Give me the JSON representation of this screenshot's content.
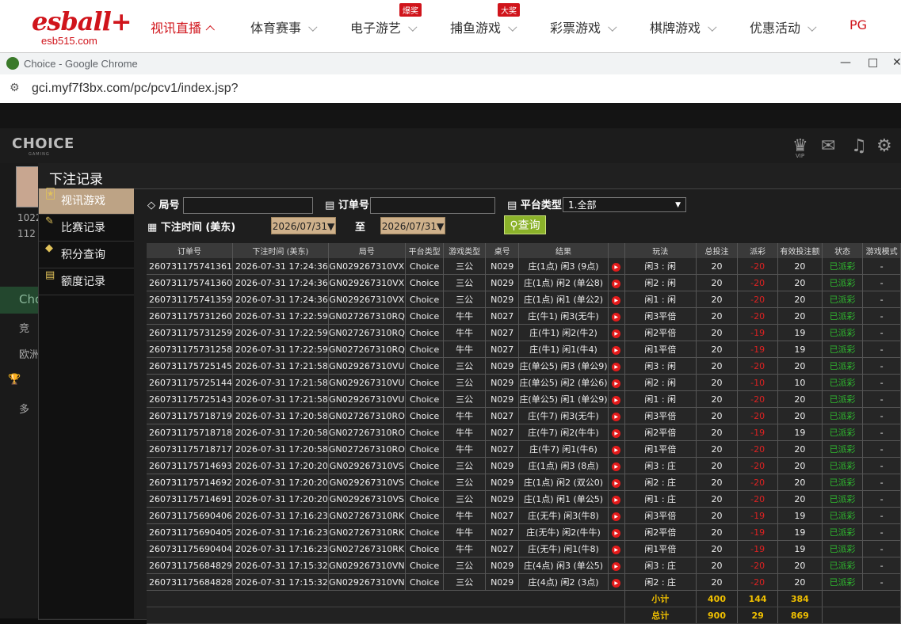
{
  "site": {
    "logo": "esball+",
    "domain": "esb515.com",
    "nav": [
      {
        "label": "视讯直播",
        "active": true
      },
      {
        "label": "体育赛事"
      },
      {
        "label": "电子游艺",
        "badge": "爆奖"
      },
      {
        "label": "捕鱼游戏",
        "badge": "大奖"
      },
      {
        "label": "彩票游戏"
      },
      {
        "label": "棋牌游戏"
      },
      {
        "label": "优惠活动"
      },
      {
        "label": "PG"
      }
    ]
  },
  "chrome": {
    "title": "Choice - Google Chrome",
    "url": "gci.myf7f3bx.com/pc/pcv1/index.jsp?"
  },
  "game": {
    "logo": "CHOICE",
    "logo_sub": "GAMING",
    "vip": "VIP",
    "bg_texts": [
      "1022",
      "112",
      "Cho",
      "竞",
      "欧洲",
      "多"
    ]
  },
  "modal": {
    "title": "下注记录",
    "menu": [
      "视讯游戏",
      "比赛记录",
      "积分查询",
      "额度记录"
    ],
    "filters": {
      "round_label": "局号",
      "order_label": "订单号",
      "platform_label": "平台类型",
      "platform_value": "1.全部",
      "time_label": "下注时间 (美东)",
      "date_from": "2026/07/31▼",
      "to_label": "至",
      "date_to": "2026/07/31▼",
      "query_label": "查询"
    },
    "table": {
      "headers": [
        "订单号",
        "下注时间 (美东)",
        "局号",
        "平台类型",
        "游戏类型",
        "桌号",
        "结果",
        "",
        "玩法",
        "总投注",
        "派彩",
        "有效投注额",
        "状态",
        "游戏模式"
      ],
      "rows": [
        [
          "260731175741361",
          "2026-07-31 17:24:36",
          "GN029267310VX",
          "Choice",
          "三公",
          "N029",
          "庄(1点) 闲3 (9点)",
          "闲3 : 闲",
          "20",
          "-20",
          "20",
          "已派彩",
          "-"
        ],
        [
          "260731175741360",
          "2026-07-31 17:24:36",
          "GN029267310VX",
          "Choice",
          "三公",
          "N029",
          "庄(1点) 闲2 (单公8)",
          "闲2 : 闲",
          "20",
          "-20",
          "20",
          "已派彩",
          "-"
        ],
        [
          "260731175741359",
          "2026-07-31 17:24:36",
          "GN029267310VX",
          "Choice",
          "三公",
          "N029",
          "庄(1点) 闲1 (单公2)",
          "闲1 : 闲",
          "20",
          "-20",
          "20",
          "已派彩",
          "-"
        ],
        [
          "260731175731260",
          "2026-07-31 17:22:59",
          "GN027267310RQ",
          "Choice",
          "牛牛",
          "N027",
          "庄(牛1) 闲3(无牛)",
          "闲3平倍",
          "20",
          "-20",
          "20",
          "已派彩",
          "-"
        ],
        [
          "260731175731259",
          "2026-07-31 17:22:59",
          "GN027267310RQ",
          "Choice",
          "牛牛",
          "N027",
          "庄(牛1) 闲2(牛2)",
          "闲2平倍",
          "20",
          "-19",
          "19",
          "已派彩",
          "-"
        ],
        [
          "260731175731258",
          "2026-07-31 17:22:59",
          "GN027267310RQ",
          "Choice",
          "牛牛",
          "N027",
          "庄(牛1) 闲1(牛4)",
          "闲1平倍",
          "20",
          "-19",
          "19",
          "已派彩",
          "-"
        ],
        [
          "260731175725145",
          "2026-07-31 17:21:58",
          "GN029267310VU",
          "Choice",
          "三公",
          "N029",
          "庄(单公5) 闲3 (单公9)",
          "闲3 : 闲",
          "20",
          "-20",
          "20",
          "已派彩",
          "-"
        ],
        [
          "260731175725144",
          "2026-07-31 17:21:58",
          "GN029267310VU",
          "Choice",
          "三公",
          "N029",
          "庄(单公5) 闲2 (单公6)",
          "闲2 : 闲",
          "20",
          "-10",
          "10",
          "已派彩",
          "-"
        ],
        [
          "260731175725143",
          "2026-07-31 17:21:58",
          "GN029267310VU",
          "Choice",
          "三公",
          "N029",
          "庄(单公5) 闲1 (单公9)",
          "闲1 : 闲",
          "20",
          "-20",
          "20",
          "已派彩",
          "-"
        ],
        [
          "260731175718719",
          "2026-07-31 17:20:58",
          "GN027267310RO",
          "Choice",
          "牛牛",
          "N027",
          "庄(牛7) 闲3(无牛)",
          "闲3平倍",
          "20",
          "-20",
          "20",
          "已派彩",
          "-"
        ],
        [
          "260731175718718",
          "2026-07-31 17:20:58",
          "GN027267310RO",
          "Choice",
          "牛牛",
          "N027",
          "庄(牛7) 闲2(牛牛)",
          "闲2平倍",
          "20",
          "-19",
          "19",
          "已派彩",
          "-"
        ],
        [
          "260731175718717",
          "2026-07-31 17:20:58",
          "GN027267310RO",
          "Choice",
          "牛牛",
          "N027",
          "庄(牛7) 闲1(牛6)",
          "闲1平倍",
          "20",
          "-20",
          "20",
          "已派彩",
          "-"
        ],
        [
          "260731175714693",
          "2026-07-31 17:20:20",
          "GN029267310VS",
          "Choice",
          "三公",
          "N029",
          "庄(1点) 闲3 (8点)",
          "闲3 : 庄",
          "20",
          "-20",
          "20",
          "已派彩",
          "-"
        ],
        [
          "260731175714692",
          "2026-07-31 17:20:20",
          "GN029267310VS",
          "Choice",
          "三公",
          "N029",
          "庄(1点) 闲2 (双公0)",
          "闲2 : 庄",
          "20",
          "-20",
          "20",
          "已派彩",
          "-"
        ],
        [
          "260731175714691",
          "2026-07-31 17:20:20",
          "GN029267310VS",
          "Choice",
          "三公",
          "N029",
          "庄(1点) 闲1 (单公5)",
          "闲1 : 庄",
          "20",
          "-20",
          "20",
          "已派彩",
          "-"
        ],
        [
          "260731175690406",
          "2026-07-31 17:16:23",
          "GN027267310RK",
          "Choice",
          "牛牛",
          "N027",
          "庄(无牛) 闲3(牛8)",
          "闲3平倍",
          "20",
          "-19",
          "19",
          "已派彩",
          "-"
        ],
        [
          "260731175690405",
          "2026-07-31 17:16:23",
          "GN027267310RK",
          "Choice",
          "牛牛",
          "N027",
          "庄(无牛) 闲2(牛牛)",
          "闲2平倍",
          "20",
          "-19",
          "19",
          "已派彩",
          "-"
        ],
        [
          "260731175690404",
          "2026-07-31 17:16:23",
          "GN027267310RK",
          "Choice",
          "牛牛",
          "N027",
          "庄(无牛) 闲1(牛8)",
          "闲1平倍",
          "20",
          "-19",
          "19",
          "已派彩",
          "-"
        ],
        [
          "260731175684829",
          "2026-07-31 17:15:32",
          "GN029267310VN",
          "Choice",
          "三公",
          "N029",
          "庄(4点) 闲3 (单公5)",
          "闲3 : 庄",
          "20",
          "-20",
          "20",
          "已派彩",
          "-"
        ],
        [
          "260731175684828",
          "2026-07-31 17:15:32",
          "GN029267310VN",
          "Choice",
          "三公",
          "N029",
          "庄(4点) 闲2 (3点)",
          "闲2 : 庄",
          "20",
          "-20",
          "20",
          "已派彩",
          "-"
        ]
      ],
      "subtotal": {
        "label": "小计",
        "total": "400",
        "payout": "144",
        "valid": "384"
      },
      "total": {
        "label": "总计",
        "total": "900",
        "payout": "29",
        "valid": "869"
      }
    }
  }
}
